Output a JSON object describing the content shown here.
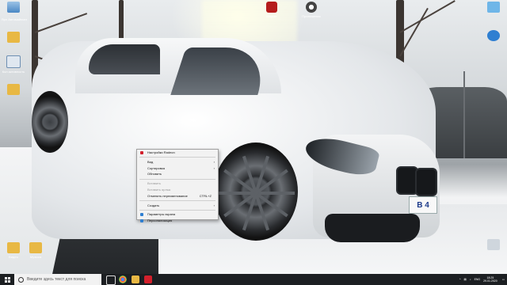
{
  "desktop": {
    "icons_left": [
      {
        "label": "",
        "icon": "recycle-bin-icon"
      },
      {
        "label": "Ярл Автомайнинг",
        "icon": "app-icon"
      },
      {
        "label": "",
        "icon": "folder-icon"
      },
      {
        "label": "Кол активность",
        "icon": "document-icon"
      },
      {
        "label": "",
        "icon": "folder-icon"
      }
    ],
    "icons_top": [
      {
        "label": "Маркет",
        "icon": "market-app-icon"
      },
      {
        "label": "Приложения",
        "icon": "apps-icon"
      }
    ],
    "icons_bottom_left": [
      {
        "label": "Видео",
        "icon": "video-folder-icon"
      },
      {
        "label": "Музыка",
        "icon": "music-folder-icon"
      }
    ],
    "plate_text": "B 4"
  },
  "context_menu": {
    "items": [
      {
        "label": "Настройки Radeon",
        "icon": "radeon-icon",
        "disabled": false,
        "shortcut": "",
        "submenu": false
      },
      {
        "sep": true
      },
      {
        "label": "Вид",
        "disabled": false,
        "shortcut": "",
        "submenu": true
      },
      {
        "label": "Сортировка",
        "disabled": false,
        "shortcut": "",
        "submenu": true
      },
      {
        "label": "Обновить",
        "disabled": false,
        "shortcut": "",
        "submenu": false
      },
      {
        "sep": true
      },
      {
        "label": "Вставить",
        "disabled": true,
        "shortcut": "",
        "submenu": false
      },
      {
        "label": "Вставить ярлык",
        "disabled": true,
        "shortcut": "",
        "submenu": false
      },
      {
        "label": "Отменить переименование",
        "disabled": false,
        "shortcut": "CTRL+Z",
        "submenu": false
      },
      {
        "sep": true
      },
      {
        "label": "Создать",
        "disabled": false,
        "shortcut": "",
        "submenu": true
      },
      {
        "sep": true
      },
      {
        "label": "Параметры экрана",
        "icon": "display-settings-icon",
        "disabled": false,
        "shortcut": "",
        "submenu": false
      },
      {
        "label": "Персонализация",
        "icon": "personalization-icon",
        "disabled": false,
        "shortcut": "",
        "submenu": false
      }
    ]
  },
  "taskbar": {
    "search_placeholder": "Введите здесь текст для поиска",
    "pinned": [
      "task-view-icon",
      "explorer-icon",
      "chrome-icon",
      "store-icon",
      "yandex-icon"
    ],
    "language": "ENG",
    "time": "18:25",
    "date": "29.01.2020"
  },
  "colors": {
    "taskbar": "#1c1f22",
    "menu_bg": "#f2f2f2",
    "radeon_red": "#d3202c",
    "accent_blue": "#2f7fd1"
  }
}
